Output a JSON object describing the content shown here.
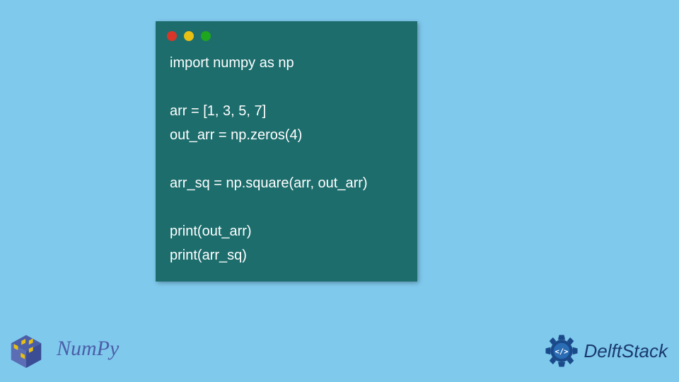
{
  "code": {
    "lines": [
      "import numpy as np",
      "",
      "arr = [1, 3, 5, 7]",
      "out_arr = np.zeros(4)",
      "",
      "arr_sq = np.square(arr, out_arr)",
      "",
      "print(out_arr)",
      "print(arr_sq)"
    ]
  },
  "logos": {
    "numpy_text": "NumPy",
    "delft_text": "DelftStack"
  }
}
